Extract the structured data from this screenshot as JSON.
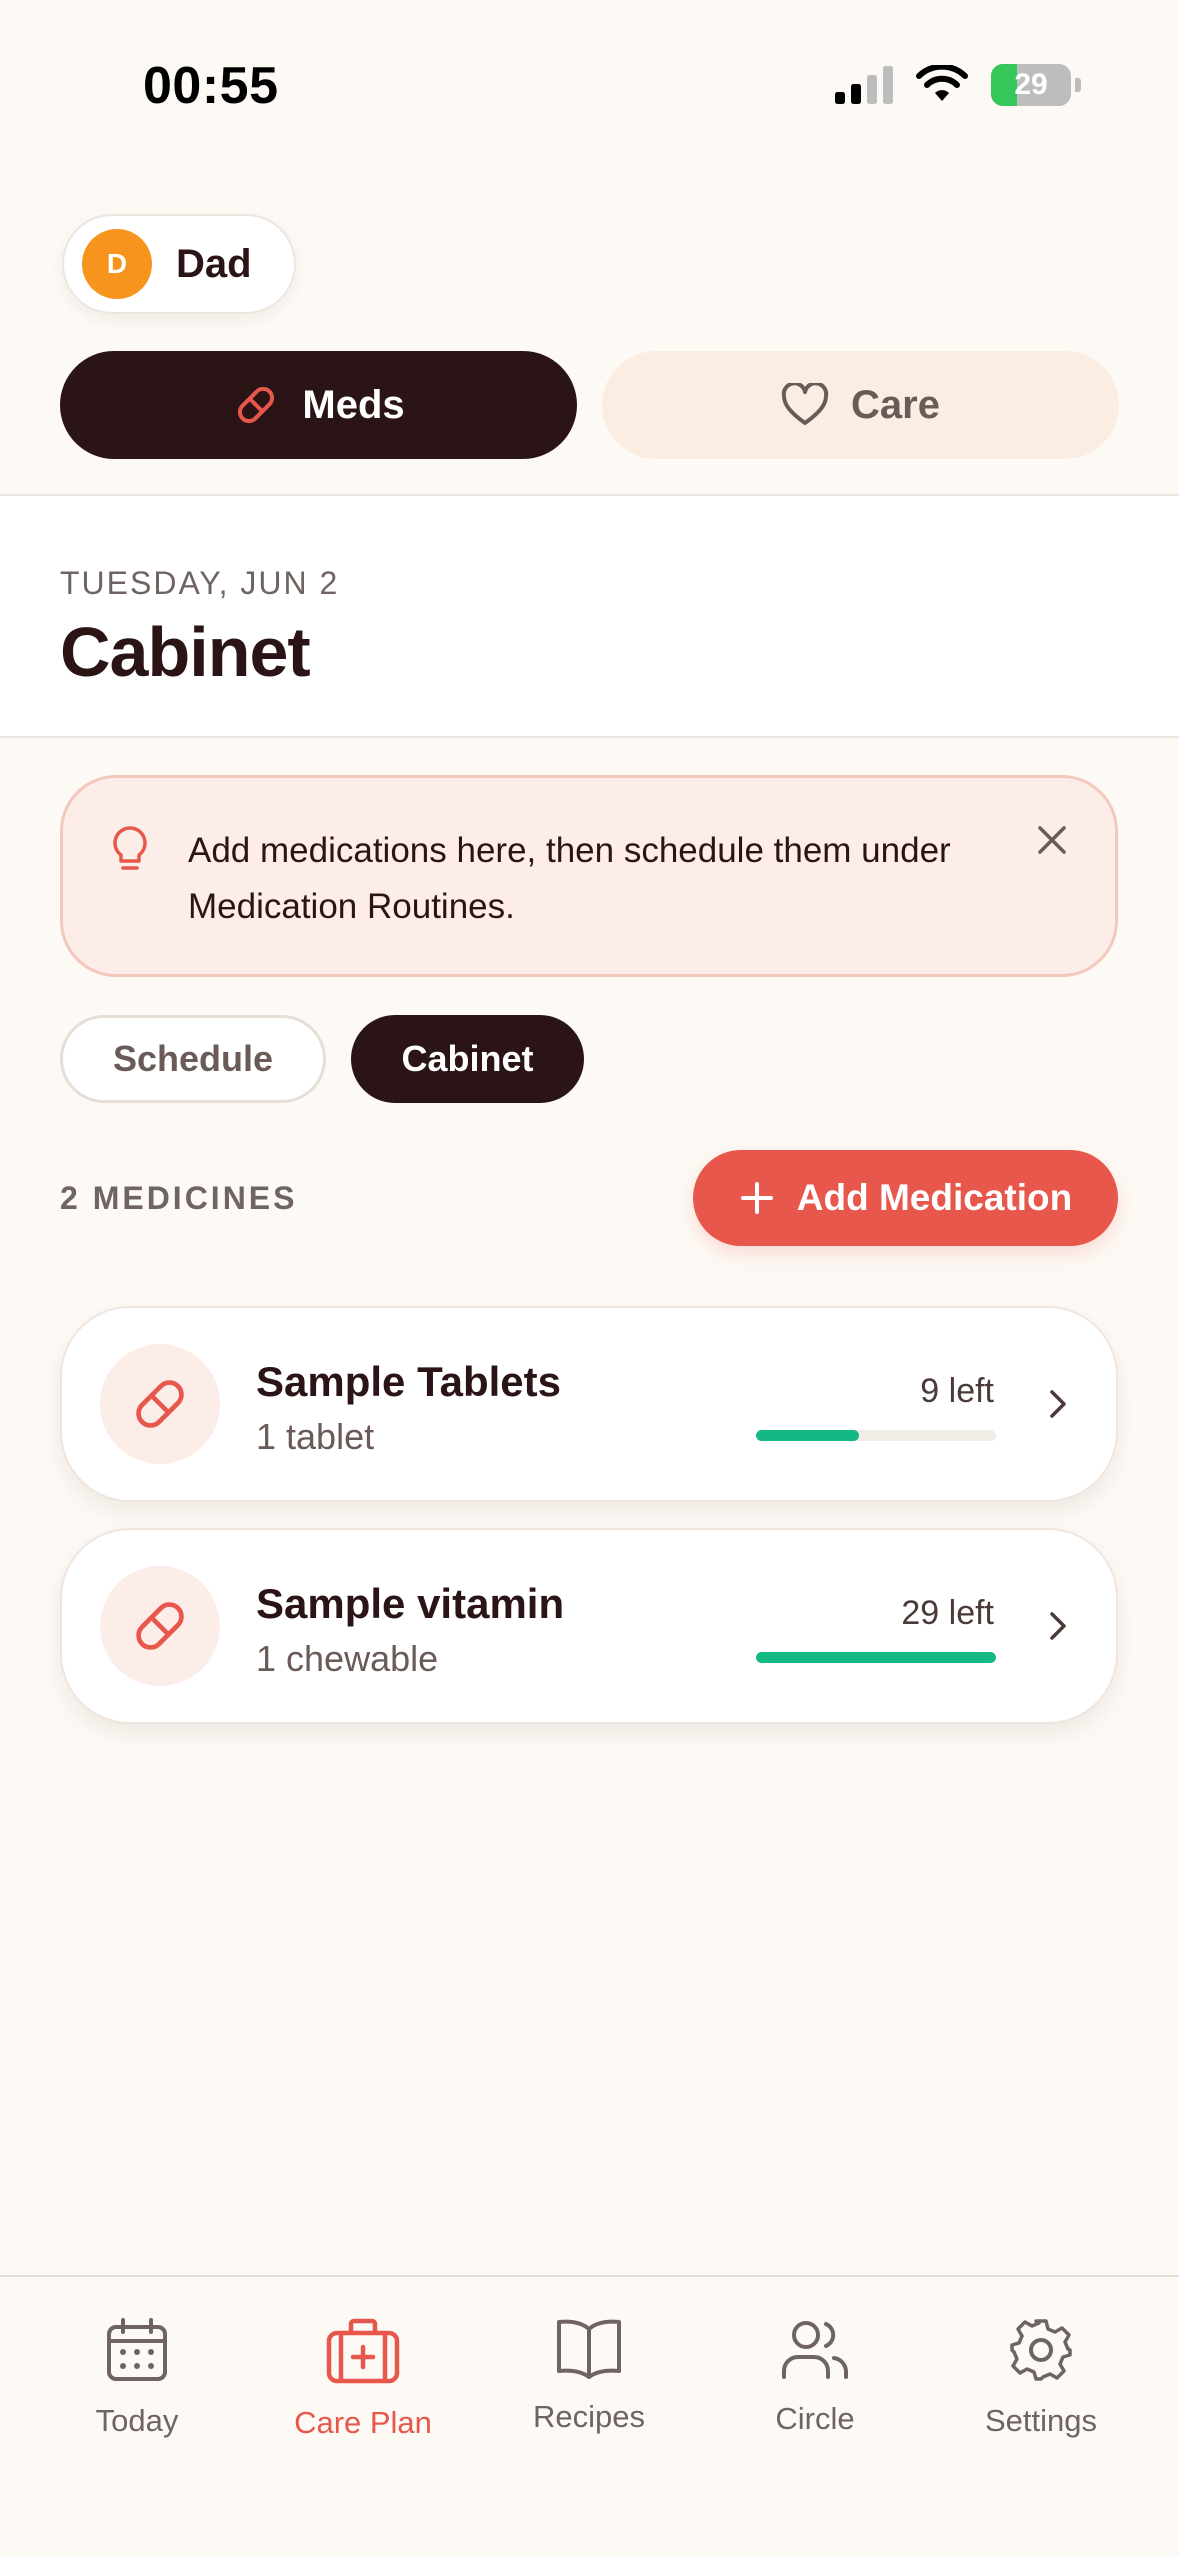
{
  "status": {
    "time": "00:55",
    "battery": "29"
  },
  "profile": {
    "initial": "D",
    "name": "Dad"
  },
  "segments": {
    "meds": "Meds",
    "care": "Care"
  },
  "header": {
    "date": "TUESDAY, JUN 2",
    "title": "Cabinet"
  },
  "tip": {
    "text": "Add medications here, then schedule them under Medication Routines."
  },
  "view_tabs": {
    "schedule": "Schedule",
    "cabinet": "Cabinet"
  },
  "list": {
    "count_label": "2 MEDICINES",
    "add_label": "Add Medication"
  },
  "medications": [
    {
      "name": "Sample Tablets",
      "dose": "1 tablet",
      "remaining": "9 left",
      "stock_fraction": 0.43
    },
    {
      "name": "Sample vitamin",
      "dose": "1 chewable",
      "remaining": "29 left",
      "stock_fraction": 1.0
    }
  ],
  "nav": [
    {
      "label": "Today",
      "icon": "calendar-icon"
    },
    {
      "label": "Care Plan",
      "icon": "medkit-icon",
      "active": true
    },
    {
      "label": "Recipes",
      "icon": "book-icon"
    },
    {
      "label": "Circle",
      "icon": "people-icon"
    },
    {
      "label": "Settings",
      "icon": "gear-icon"
    }
  ],
  "colors": {
    "accent": "#E8574B",
    "dark": "#2A1416",
    "stock": "#13B884",
    "background": "#FDF9F4"
  }
}
